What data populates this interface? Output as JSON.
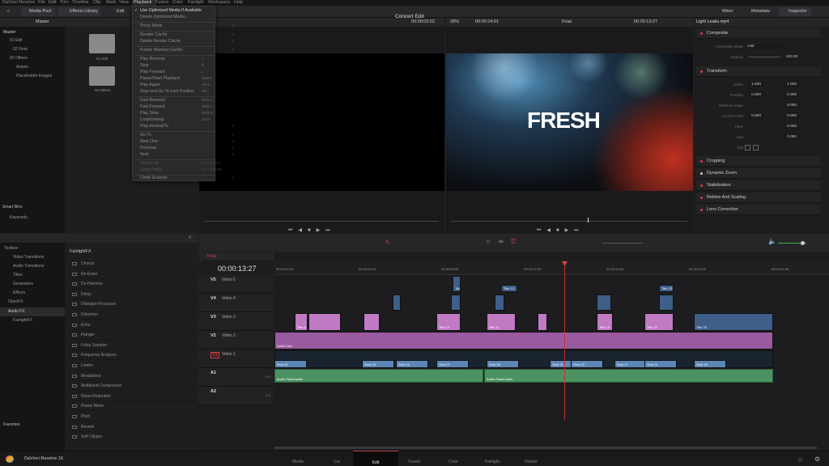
{
  "menubar": [
    "DaVinci Resolve",
    "File",
    "Edit",
    "Trim",
    "Timeline",
    "Clip",
    "Mark",
    "View",
    "Playback",
    "Fusion",
    "Color",
    "Fairlight",
    "Workspace",
    "Help"
  ],
  "toolbar": {
    "media_pool": "Media Pool",
    "effects_library": "Effects Library",
    "edit_index": "Edit Inde",
    "project_title": "Concert Edit",
    "mixer": "Mixer",
    "metadata": "Metadata",
    "inspector": "Inspector"
  },
  "playback_menu": {
    "items": [
      {
        "label": "Use Optimized Media If Available",
        "checked": true
      },
      {
        "label": "Delete Optimized Media..."
      },
      {
        "label": "Proxy Mode",
        "submenu": true
      },
      {
        "label": "Render Cache",
        "submenu": true
      },
      {
        "label": "Delete Render Cache",
        "submenu": true
      },
      {
        "label": "Fusion Memory Cache",
        "submenu": true
      },
      {
        "label": "Play Reverse",
        "shortcut": "J"
      },
      {
        "label": "Stop",
        "shortcut": "K"
      },
      {
        "label": "Play Forward",
        "shortcut": "L"
      },
      {
        "label": "Pause/Start Playback",
        "shortcut": "Space"
      },
      {
        "label": "Play Again",
        "shortcut": "Alt+L"
      },
      {
        "label": "Stop and Go To Last Position",
        "shortcut": "Alt+/"
      },
      {
        "label": "Fast Reverse",
        "shortcut": "Shift+J"
      },
      {
        "label": "Fast Forward",
        "shortcut": "Shift+L"
      },
      {
        "label": "Play Slow",
        "shortcut": "Shift+K"
      },
      {
        "label": "Loop/Unloop",
        "shortcut": "Ctrl+/"
      },
      {
        "label": "Play Around/To",
        "submenu": true
      },
      {
        "label": "Go To",
        "submenu": true
      },
      {
        "label": "Step One",
        "submenu": true
      },
      {
        "label": "Previous",
        "submenu": true
      },
      {
        "label": "Next",
        "submenu": true
      },
      {
        "label": "Jump Left",
        "shortcut": "Ctrl+Shift+L"
      },
      {
        "label": "Jump Right",
        "shortcut": "Ctrl+Shift+R"
      },
      {
        "label": "Cintel Scanner",
        "submenu": true
      }
    ]
  },
  "media_pool": {
    "root": "Master",
    "bins": [
      "Master",
      "01 Edit",
      "02 Final",
      "03 Others",
      "Assets",
      "Placeholder Images"
    ],
    "folders": [
      "01 Edit",
      "03 Others"
    ],
    "smart_bins": "Smart Bins",
    "keywords": "Keywords"
  },
  "source_viewer": {
    "timecode": "00:00:03:02"
  },
  "timeline_viewer": {
    "zoom": "39%",
    "source_tc": "00:00:24:01",
    "timeline_name": "Final",
    "tc": "00:00:13:27",
    "overlay_text": "FRESH"
  },
  "effects": {
    "toolbox": "Toolbox",
    "categories": [
      "Toolbox",
      "Video Transitions",
      "Audio Transitions",
      "Titles",
      "Generators",
      "Effects",
      "OpenFX",
      "Audio FX",
      "FairlightFX"
    ],
    "list_title": "FairlightFX",
    "items": [
      "Chorus",
      "De-Esser",
      "De-Hummer",
      "Delay",
      "Dialogue Processor",
      "Distortion",
      "Echo",
      "Flanger",
      "Foley Sampler",
      "Frequency Analyzer",
      "Limiter",
      "Modulation",
      "Multiband Compressor",
      "Noise Reduction",
      "Phase Meter",
      "Pitch",
      "Reverb",
      "Soft Clipper"
    ],
    "favorites": "Favorites"
  },
  "inspector": {
    "clip_name": "Light Leaks.mp4",
    "composite": {
      "title": "Composite",
      "mode_label": "Composite Mode",
      "mode": "Add",
      "opacity_label": "Opacity",
      "opacity": "100.00"
    },
    "transform": {
      "title": "Transform",
      "zoom_label": "Zoom",
      "zoom_x": "1.000",
      "zoom_y": "1.000",
      "position_label": "Position",
      "pos_x": "0.000",
      "pos_y": "0.000",
      "rotation_label": "Rotation Angle",
      "rotation": "0.000",
      "anchor_label": "Anchor Point",
      "anchor_x": "0.000",
      "anchor_y": "0.000",
      "pitch_label": "Pitch",
      "pitch": "0.000",
      "yaw_label": "Yaw",
      "yaw": "0.000",
      "flip_label": "Flip"
    },
    "sections": [
      "Cropping",
      "Dynamic Zoom",
      "Stabilization",
      "Retime And Scaling",
      "Lens Correction"
    ]
  },
  "timeline": {
    "name": "Final",
    "timecode": "00:00:13:27",
    "ruler": [
      "00:00:00:00",
      "00:00:04:00",
      "00:00:08:00",
      "00:00:12:00",
      "00:00:16:00",
      "00:00:20:00",
      "00:00:24:00"
    ],
    "tracks": [
      {
        "id": "V5",
        "name": "Video 5"
      },
      {
        "id": "V4",
        "name": "Video 4"
      },
      {
        "id": "V3",
        "name": "Video 3"
      },
      {
        "id": "V2",
        "name": "Video 2"
      },
      {
        "id": "V1",
        "name": "Video 1"
      },
      {
        "id": "A1",
        "name": "",
        "vol": "2.0"
      },
      {
        "id": "A2",
        "name": "",
        "vol": "2.0"
      }
    ],
    "clip_labels": {
      "v5": [
        "Title 12",
        "Title 13",
        "Title 23"
      ],
      "v3": [
        "Title 5",
        "Title 10",
        "Title 11",
        "Title 19",
        "Title 20",
        "Title 22",
        "Title 25"
      ],
      "v1": [
        "Shot 01",
        "Shot 05",
        "Shot 06",
        "Shot 07",
        "Shot 08",
        "Shot 11",
        "Shot 13",
        "Shot 17",
        "Shot 21",
        "Shot 16"
      ],
      "audio": [
        "Audio Placeholder",
        "Audio Placeholder"
      ],
      "solid": "Solid Color"
    }
  },
  "pages": [
    "Media",
    "Cut",
    "Edit",
    "Fusion",
    "Color",
    "Fairlight",
    "Deliver"
  ],
  "active_page": "Edit",
  "app_name": "DaVinci Resolve 16"
}
